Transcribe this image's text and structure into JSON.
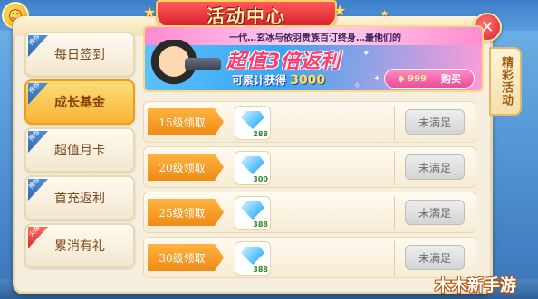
{
  "window": {
    "title": "活动中心"
  },
  "colors": {
    "accent": "#f08a16",
    "banner": "#d61f2d",
    "gem": "#5cc2ff",
    "disabled": "#d4d4d4"
  },
  "side_tab": {
    "label": "精彩活动"
  },
  "nav": {
    "items": [
      {
        "label": "每日签到",
        "tag": "推荐",
        "active": false
      },
      {
        "label": "成长基金",
        "tag": "推荐",
        "active": true
      },
      {
        "label": "超值月卡",
        "tag": "推荐",
        "active": false
      },
      {
        "label": "首充返利",
        "tag": "推荐",
        "active": false
      },
      {
        "label": "累消有礼",
        "tag": "火爆",
        "active": false
      }
    ]
  },
  "promo": {
    "top_line": "一代…玄冰与依羽贵族百订终身…最他们的",
    "headline": "超值3倍返利",
    "sub_prefix": "可累计获得",
    "sub_amount": "3000",
    "price": "999",
    "buy_label": "购买",
    "character": "gunner-character"
  },
  "rows": [
    {
      "level": "15级领取",
      "reward_icon": "diamond-icon",
      "qty": "288",
      "status": "未满足"
    },
    {
      "level": "20级领取",
      "reward_icon": "diamond-icon",
      "qty": "300",
      "status": "未满足"
    },
    {
      "level": "25级领取",
      "reward_icon": "diamond-icon",
      "qty": "388",
      "status": "未满足"
    },
    {
      "level": "30级领取",
      "reward_icon": "diamond-icon",
      "qty": "388",
      "status": "未满足"
    }
  ],
  "watermark": "木木新手游"
}
